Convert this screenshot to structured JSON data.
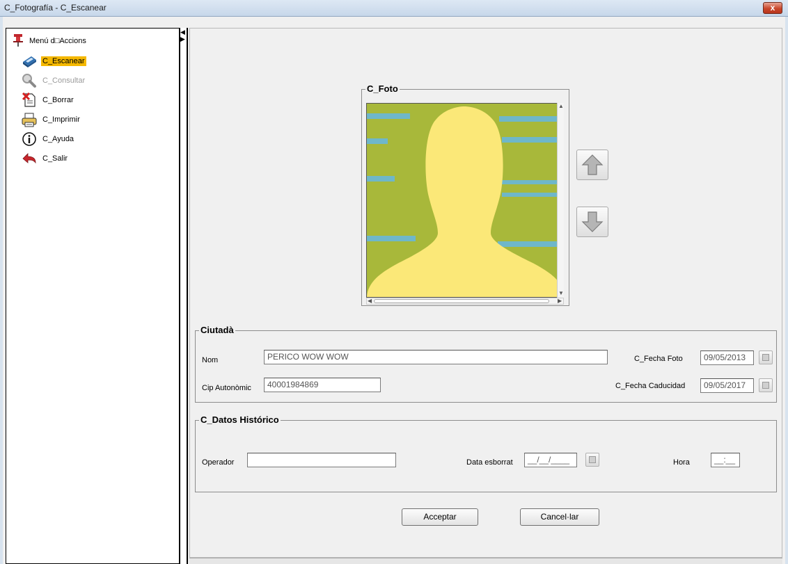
{
  "window": {
    "title": "C_Fotografía - C_Escanear",
    "close_glyph": "x"
  },
  "menu": {
    "header": "Menú d□Accions",
    "items": [
      {
        "label": "C_Escanear",
        "icon": "scanner-icon",
        "state": "selected"
      },
      {
        "label": "C_Consultar",
        "icon": "magnifier-icon",
        "state": "disabled"
      },
      {
        "label": "C_Borrar",
        "icon": "delete-document-icon",
        "state": "normal"
      },
      {
        "label": "C_Imprimir",
        "icon": "printer-icon",
        "state": "normal"
      },
      {
        "label": "C_Ayuda",
        "icon": "info-icon",
        "state": "normal"
      },
      {
        "label": "C_Salir",
        "icon": "exit-arrow-icon",
        "state": "normal"
      }
    ]
  },
  "foto": {
    "legend": "C_Foto",
    "image": "placeholder-silhouette"
  },
  "ciutada": {
    "legend": "Ciutadà",
    "nom_label": "Nom",
    "nom_value": "PERICO WOW WOW",
    "cip_label": "Cip Autonòmic",
    "cip_value": "40001984869",
    "fecha_foto_label": "C_Fecha Foto",
    "fecha_foto_value": "09/05/2013",
    "fecha_caducidad_label": "C_Fecha Caducidad",
    "fecha_caducidad_value": "09/05/2017"
  },
  "historico": {
    "legend": "C_Datos Histórico",
    "operador_label": "Operador",
    "operador_value": "",
    "data_label": "Data esborrat",
    "data_value": "__/__/____",
    "hora_label": "Hora",
    "hora_value": "__:__"
  },
  "buttons": {
    "accept": "Acceptar",
    "cancel": "Cancel·lar"
  },
  "colors": {
    "selected_highlight": "#f5b800",
    "photo_background": "#a8b83a",
    "silhouette": "#fbe878"
  }
}
